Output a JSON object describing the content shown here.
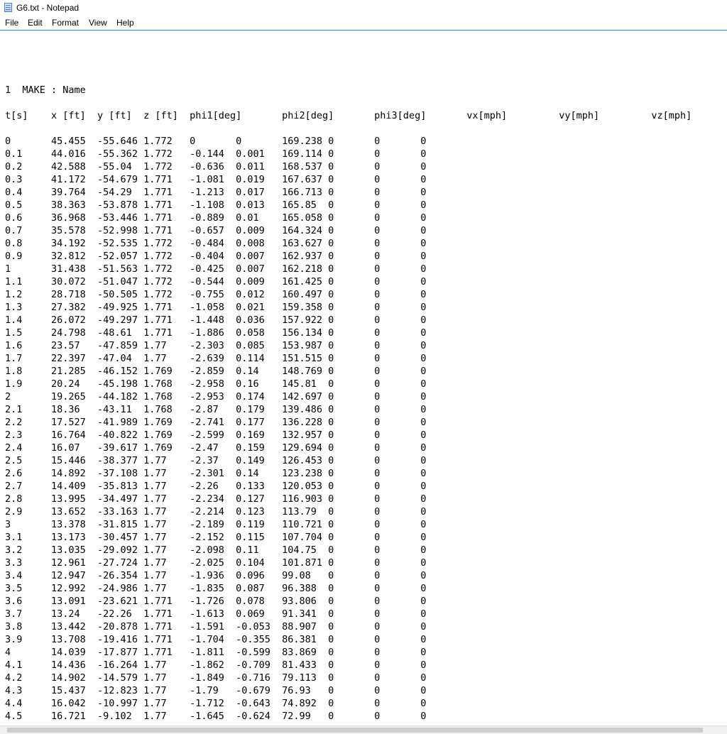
{
  "window": {
    "title": "G6.txt - Notepad",
    "icon": "notepad-icon"
  },
  "menu": {
    "file": "File",
    "edit": "Edit",
    "format": "Format",
    "view": "View",
    "help": "Help"
  },
  "document": {
    "content": "1  MAKE : Name\n\nt[s]\tx [ft]\ty [ft]\tz [ft]\tphi1[deg]\tphi2[deg]\tphi3[deg]\tvx[mph]\t\tvy[mph]\t\tvz[mph]\n\n0\t45.455\t-55.646\t1.772\t0\t0\t169.238\t0\t0\t0\n0.1\t44.016\t-55.362\t1.772\t-0.144\t0.001\t169.114\t0\t0\t0\n0.2\t42.588\t-55.04\t1.772\t-0.636\t0.011\t168.537\t0\t0\t0\n0.3\t41.172\t-54.679\t1.771\t-1.081\t0.019\t167.637\t0\t0\t0\n0.4\t39.764\t-54.29\t1.771\t-1.213\t0.017\t166.713\t0\t0\t0\n0.5\t38.363\t-53.878\t1.771\t-1.108\t0.013\t165.85\t0\t0\t0\n0.6\t36.968\t-53.446\t1.771\t-0.889\t0.01\t165.058\t0\t0\t0\n0.7\t35.578\t-52.998\t1.771\t-0.657\t0.009\t164.324\t0\t0\t0\n0.8\t34.192\t-52.535\t1.772\t-0.484\t0.008\t163.627\t0\t0\t0\n0.9\t32.812\t-52.057\t1.772\t-0.404\t0.007\t162.937\t0\t0\t0\n1\t31.438\t-51.563\t1.772\t-0.425\t0.007\t162.218\t0\t0\t0\n1.1\t30.072\t-51.047\t1.772\t-0.544\t0.009\t161.425\t0\t0\t0\n1.2\t28.718\t-50.505\t1.772\t-0.755\t0.012\t160.497\t0\t0\t0\n1.3\t27.382\t-49.925\t1.771\t-1.058\t0.021\t159.358\t0\t0\t0\n1.4\t26.072\t-49.297\t1.771\t-1.448\t0.036\t157.922\t0\t0\t0\n1.5\t24.798\t-48.61\t1.771\t-1.886\t0.058\t156.134\t0\t0\t0\n1.6\t23.57\t-47.859\t1.77\t-2.303\t0.085\t153.987\t0\t0\t0\n1.7\t22.397\t-47.04\t1.77\t-2.639\t0.114\t151.515\t0\t0\t0\n1.8\t21.285\t-46.152\t1.769\t-2.859\t0.14\t148.769\t0\t0\t0\n1.9\t20.24\t-45.198\t1.768\t-2.958\t0.16\t145.81\t0\t0\t0\n2\t19.265\t-44.182\t1.768\t-2.953\t0.174\t142.697\t0\t0\t0\n2.1\t18.36\t-43.11\t1.768\t-2.87\t0.179\t139.486\t0\t0\t0\n2.2\t17.527\t-41.989\t1.769\t-2.741\t0.177\t136.228\t0\t0\t0\n2.3\t16.764\t-40.822\t1.769\t-2.599\t0.169\t132.957\t0\t0\t0\n2.4\t16.07\t-39.617\t1.769\t-2.47\t0.159\t129.694\t0\t0\t0\n2.5\t15.446\t-38.377\t1.77\t-2.37\t0.149\t126.453\t0\t0\t0\n2.6\t14.892\t-37.108\t1.77\t-2.301\t0.14\t123.238\t0\t0\t0\n2.7\t14.409\t-35.813\t1.77\t-2.26\t0.133\t120.053\t0\t0\t0\n2.8\t13.995\t-34.497\t1.77\t-2.234\t0.127\t116.903\t0\t0\t0\n2.9\t13.652\t-33.163\t1.77\t-2.214\t0.123\t113.79\t0\t0\t0\n3\t13.378\t-31.815\t1.77\t-2.189\t0.119\t110.721\t0\t0\t0\n3.1\t13.173\t-30.457\t1.77\t-2.152\t0.115\t107.704\t0\t0\t0\n3.2\t13.035\t-29.092\t1.77\t-2.098\t0.11\t104.75\t0\t0\t0\n3.3\t12.961\t-27.724\t1.77\t-2.025\t0.104\t101.871\t0\t0\t0\n3.4\t12.947\t-26.354\t1.77\t-1.936\t0.096\t99.08\t0\t0\t0\n3.5\t12.992\t-24.986\t1.77\t-1.835\t0.087\t96.388\t0\t0\t0\n3.6\t13.091\t-23.621\t1.771\t-1.726\t0.078\t93.806\t0\t0\t0\n3.7\t13.24\t-22.26\t1.771\t-1.613\t0.069\t91.341\t0\t0\t0\n3.8\t13.442\t-20.878\t1.771\t-1.591\t-0.053\t88.907\t0\t0\t0\n3.9\t13.708\t-19.416\t1.771\t-1.704\t-0.355\t86.381\t0\t0\t0\n4\t14.039\t-17.877\t1.771\t-1.811\t-0.599\t83.869\t0\t0\t0\n4.1\t14.436\t-16.264\t1.77\t-1.862\t-0.709\t81.433\t0\t0\t0\n4.2\t14.902\t-14.579\t1.77\t-1.849\t-0.716\t79.113\t0\t0\t0\n4.3\t15.437\t-12.823\t1.77\t-1.79\t-0.679\t76.93\t0\t0\t0\n4.4\t16.042\t-10.997\t1.77\t-1.712\t-0.643\t74.892\t0\t0\t0\n4.5\t16.721\t-9.102\t1.77\t-1.645\t-0.624\t72.99\t0\t0\t0"
  }
}
